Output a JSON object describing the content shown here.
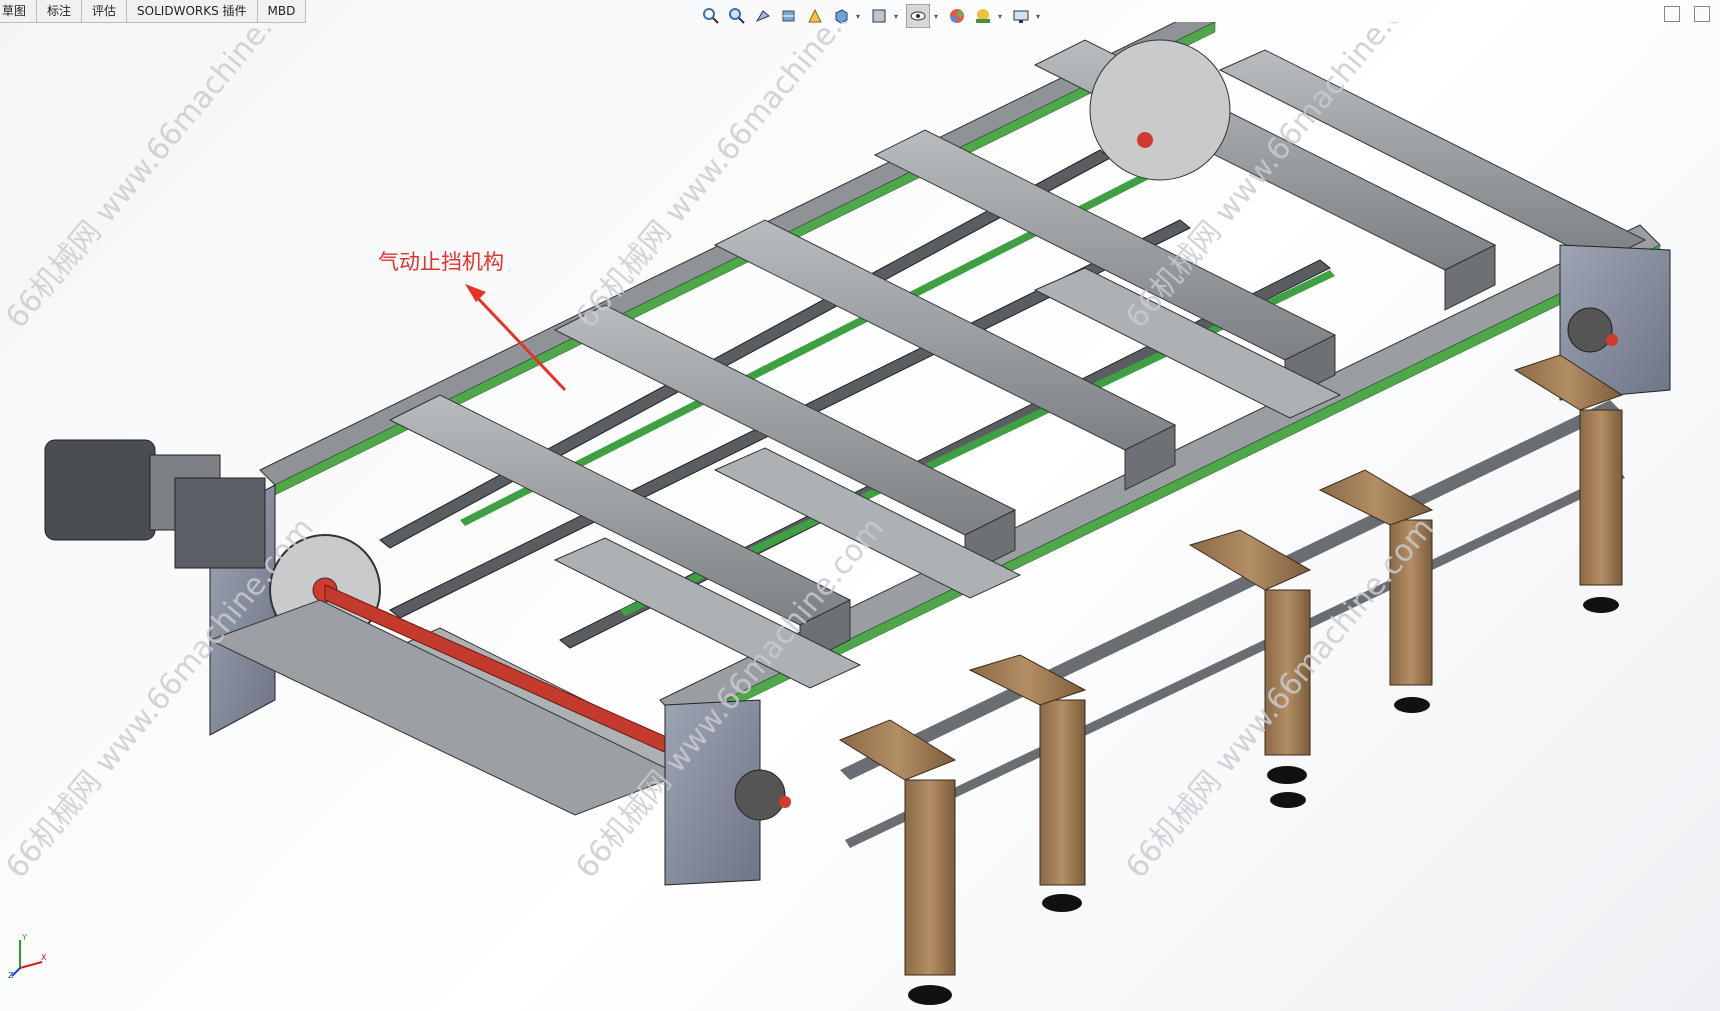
{
  "tabs": [
    "草图",
    "标注",
    "评估",
    "SOLIDWORKS 插件",
    "MBD"
  ],
  "view_toolbar_icons": [
    "zoom-to-fit-icon",
    "zoom-area-icon",
    "previous-view-icon",
    "section-view-icon",
    "dynamic-annotation-icon",
    "view-orientation-icon",
    "display-style-icon",
    "hide-show-icon",
    "edit-appearance-icon",
    "apply-scene-icon",
    "view-settings-icon"
  ],
  "annotation": {
    "text": "气动止挡机构",
    "color": "#e4332b"
  },
  "watermark": "66机械网 www.66machine.com",
  "triad_labels": {
    "y": "Y",
    "x": "X",
    "z": "Z"
  }
}
